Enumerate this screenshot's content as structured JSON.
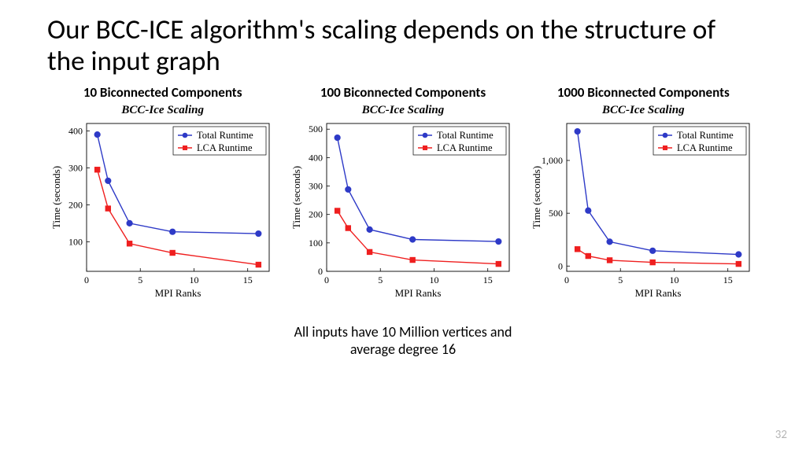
{
  "title": "Our BCC-ICE algorithm's scaling depends on the structure of the input graph",
  "footnote_line1": "All inputs have 10 Million vertices and",
  "footnote_line2": "average degree 16",
  "page_number": "32",
  "legend": {
    "series_a": "Total Runtime",
    "series_b": "LCA Runtime"
  },
  "axis": {
    "x": "MPI Ranks",
    "y": "Time (seconds)"
  },
  "captions": {
    "c1": "10 Biconnected Components",
    "c2": "100 Biconnected Components",
    "c3": "1000 Biconnected Components"
  },
  "shared_chart_title": "BCC-Ice Scaling",
  "chart_data": [
    {
      "type": "line",
      "title": "BCC-Ice Scaling",
      "caption": "10 Biconnected Components",
      "xlabel": "MPI Ranks",
      "ylabel": "Time (seconds)",
      "x": [
        1,
        2,
        4,
        8,
        16
      ],
      "xlim": [
        0,
        17
      ],
      "ylim": [
        20,
        420
      ],
      "yticks": [
        100,
        200,
        300,
        400
      ],
      "series": [
        {
          "name": "Total Runtime",
          "values": [
            390,
            265,
            150,
            127,
            122
          ],
          "color": "#2e3ac7",
          "marker": "circle"
        },
        {
          "name": "LCA Runtime",
          "values": [
            295,
            190,
            95,
            70,
            38
          ],
          "color": "#ef1f1f",
          "marker": "square"
        }
      ]
    },
    {
      "type": "line",
      "title": "BCC-Ice Scaling",
      "caption": "100 Biconnected Components",
      "xlabel": "MPI Ranks",
      "ylabel": "Time (seconds)",
      "x": [
        1,
        2,
        4,
        8,
        16
      ],
      "xlim": [
        0,
        17
      ],
      "ylim": [
        0,
        520
      ],
      "yticks": [
        0,
        100,
        200,
        300,
        400,
        500
      ],
      "series": [
        {
          "name": "Total Runtime",
          "values": [
            470,
            288,
            147,
            112,
            105
          ],
          "color": "#2e3ac7",
          "marker": "circle"
        },
        {
          "name": "LCA Runtime",
          "values": [
            213,
            152,
            68,
            40,
            26
          ],
          "color": "#ef1f1f",
          "marker": "square"
        }
      ]
    },
    {
      "type": "line",
      "title": "BCC-Ice Scaling",
      "caption": "1000 Biconnected Components",
      "xlabel": "MPI Ranks",
      "ylabel": "Time (seconds)",
      "x": [
        1,
        2,
        4,
        8,
        16
      ],
      "xlim": [
        0,
        17
      ],
      "ylim": [
        -50,
        1350
      ],
      "yticks": [
        0,
        500,
        1000
      ],
      "series": [
        {
          "name": "Total Runtime",
          "values": [
            1275,
            525,
            230,
            145,
            110
          ],
          "color": "#2e3ac7",
          "marker": "circle"
        },
        {
          "name": "LCA Runtime",
          "values": [
            160,
            95,
            55,
            35,
            20
          ],
          "color": "#ef1f1f",
          "marker": "square"
        }
      ]
    }
  ]
}
